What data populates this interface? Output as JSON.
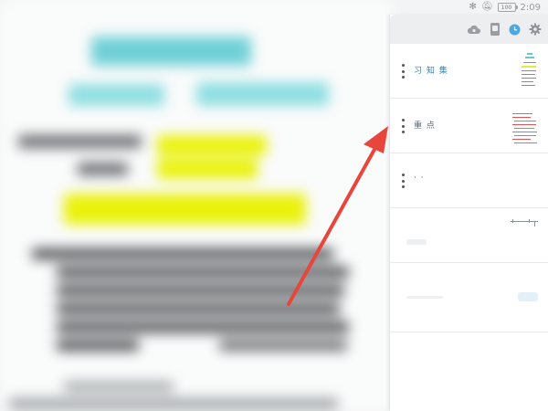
{
  "status_bar": {
    "bluetooth_icon": "bluetooth-icon",
    "mute_icon": "bell-mute-icon",
    "battery_level": "100",
    "time": "2:09"
  },
  "toolbar": {
    "cloud_icon": "cloud-sync-icon",
    "device_icon": "device-icon",
    "clock_icon": "clock-icon",
    "settings_icon": "gear-icon",
    "accent_color": "#4ea8e0"
  },
  "pages": [
    {
      "title": "习 知 集",
      "has_thumbnail": true
    },
    {
      "title": "重 点",
      "has_thumbnail": true
    },
    {
      "title": "· ·",
      "has_thumbnail": false
    },
    {
      "title": "",
      "has_thumbnail": true
    },
    {
      "title": "",
      "has_thumbnail": false
    }
  ],
  "annotation": {
    "arrow_color": "#e8453c"
  },
  "document": {
    "highlight_color": "#eaf20a",
    "heading_color": "#6fd0d6"
  }
}
